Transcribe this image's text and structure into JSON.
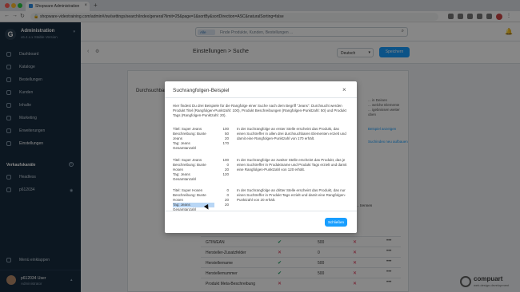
{
  "browser": {
    "tab_title": "Shopware Administration",
    "url": "shopware-videotraining.com/admin#/sw/settings/search/index/general?limit=25&page=1&sortBy&sortDirection=ASC&naturalSorting=false"
  },
  "sidebar": {
    "title": "Administration",
    "version": "v6.4.x.x Stable Version",
    "items": [
      {
        "label": "Dashboard",
        "icon": "dashboard-icon"
      },
      {
        "label": "Kataloge",
        "icon": "catalog-icon"
      },
      {
        "label": "Bestellungen",
        "icon": "orders-icon"
      },
      {
        "label": "Kunden",
        "icon": "customers-icon"
      },
      {
        "label": "Inhalte",
        "icon": "content-icon"
      },
      {
        "label": "Marketing",
        "icon": "marketing-icon"
      },
      {
        "label": "Erweiterungen",
        "icon": "extensions-icon"
      },
      {
        "label": "Einstellungen",
        "icon": "settings-icon"
      }
    ],
    "sales_channels_title": "Verkaufskanäle",
    "sales_channels": [
      "Headless",
      "p612034"
    ],
    "collapse_label": "Menü einklappen",
    "user_name": "p612034 User",
    "user_role": "Administrator"
  },
  "topbar": {
    "search_type": "Alle",
    "search_placeholder": "Finde Produkte, Kunden, Bestellungen ..."
  },
  "smartbar": {
    "title": "Einstellungen > Suche",
    "language": "Deutsch",
    "save_label": "Speichern"
  },
  "content": {
    "card_title": "Durchsuchbare Inhalte",
    "right_text_1": "... in Deinen",
    "right_text_2": "... welche Elemente",
    "right_text_3": "... igebnissen weiter oben",
    "link_1": "Beispiel anzeigen",
    "link_2": "Suchindex neu aufbauen",
    "rules_header": "... trennen",
    "rows": [
      {
        "name": "GTIN/EAN",
        "searchable": true,
        "ranking": "500"
      },
      {
        "name": "Hersteller-Zusatzfelder",
        "searchable": false,
        "ranking": "0"
      },
      {
        "name": "Herstellername",
        "searchable": true,
        "ranking": "500"
      },
      {
        "name": "Herstellernummer",
        "searchable": true,
        "ranking": "500"
      },
      {
        "name": "Produkt Meta-Beschreibung",
        "searchable": false,
        "ranking": ""
      }
    ]
  },
  "modal": {
    "title": "Suchrangfolgen-Beispiel",
    "intro": "Hier findest Du drei Beispiele für die Rangfolge einer Suche nach dem Begriff \"Jeans\". Durchsucht werden Produkt Titel (Rangfolgen-Punktzahl: 100), Produkt Beschreibungen (Rangfolgen-Punktzahl: 50) und Produkt Tags (Rangfolgen-Punktzahl: 20).",
    "examples": [
      {
        "labels": [
          "Titel: Super Jeans",
          "Beschreibung: Bunte Jeans",
          "Tag: Jeans",
          "Gesamtanzahl"
        ],
        "values": [
          "100",
          "50",
          "20",
          "170"
        ],
        "desc": "In der Suchrangfolge an erster Stelle erscheint das Produkt, das einen Suchtreffer in allen drei durchsuchbaren Elementen erzielt und damit eine Rangfolgen-Punktzahl von 170 erhält."
      },
      {
        "labels": [
          "Titel: Super Jeans",
          "Beschreibung: Bunte Hosen",
          "Tag: Jeans",
          "Gesamtanzahl"
        ],
        "values": [
          "100",
          "0",
          "20",
          "120"
        ],
        "desc": "In der Suchrangfolge an zweiter Stelle erscheint das Produkt, das je einen Suchtreffer in Produktname und Produkt Tags erzielt und damit eine Rangfolgen-Punktzahl von 120 erhält."
      },
      {
        "labels": [
          "Titel: Super Hosen",
          "Beschreibung: Bunte Hosen",
          "Tag: Jeans",
          "Gesamtanzahl"
        ],
        "values": [
          "0",
          "0",
          "20",
          "20"
        ],
        "desc": "In der Suchrangfolge an dritter Stelle erscheint das Produkt, das nur einen Suchtreffer in Produkt Tags erzielt und damit eine Rangfolgen-Punktzahl von 20 erhält."
      }
    ],
    "close_label": "Schließen"
  },
  "watermark": {
    "name": "compuart",
    "sub": "web.design.development"
  },
  "colors": {
    "sidebar_bg": "#172c3f",
    "accent": "#189eff",
    "check": "#1c9f66",
    "cross": "#de294c"
  }
}
